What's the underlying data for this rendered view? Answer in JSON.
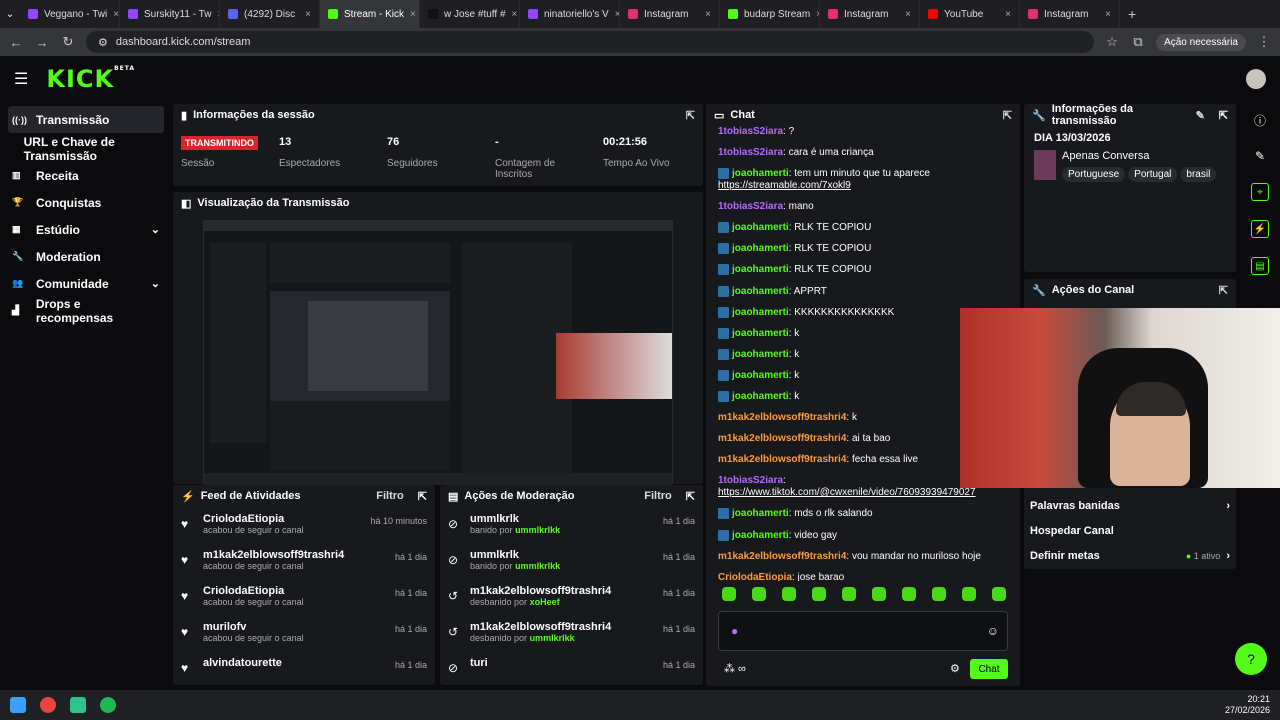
{
  "browser": {
    "tabs": [
      {
        "label": "Veggano - Twi",
        "color": "#9146ff"
      },
      {
        "label": "Surskity11 - Tw",
        "color": "#9146ff"
      },
      {
        "label": "(4292) Disc",
        "color": "#5865f2"
      },
      {
        "label": "Stream - Kick",
        "color": "#53fc18",
        "active": true
      },
      {
        "label": "w Jose #tuff #",
        "color": "#111111"
      },
      {
        "label": "ninatoriello's V",
        "color": "#9146ff"
      },
      {
        "label": "Instagram",
        "color": "#e1306c"
      },
      {
        "label": "budarp Stream",
        "color": "#53fc18"
      },
      {
        "label": "Instagram",
        "color": "#e1306c"
      },
      {
        "label": "YouTube",
        "color": "#ff0000"
      },
      {
        "label": "Instagram",
        "color": "#e1306c"
      }
    ],
    "url": "dashboard.kick.com/stream",
    "profile_label": "Ação necessária"
  },
  "brand": {
    "logo": "KICK",
    "logo_sup": "BETA",
    "accent": "#53fc18"
  },
  "sidebar": {
    "items": [
      {
        "label": "Transmissão",
        "icon": "broadcast-icon",
        "active": true
      },
      {
        "label": "URL e Chave de Transmissão",
        "icon": ""
      },
      {
        "label": "Receita",
        "icon": "chart-icon"
      },
      {
        "label": "Conquistas",
        "icon": "trophy-icon"
      },
      {
        "label": "Estúdio",
        "icon": "studio-icon",
        "chev": true
      },
      {
        "label": "Moderation",
        "icon": "wrench-icon"
      },
      {
        "label": "Comunidade",
        "icon": "people-icon",
        "chev": true
      },
      {
        "label": "Drops e recompensas",
        "icon": "gift-icon"
      }
    ]
  },
  "session": {
    "title": "Informações da sessão",
    "badge": "TRANSMITINDO",
    "badge_label": "Sessão",
    "stats": [
      {
        "value": "13",
        "label": "Espectadores"
      },
      {
        "value": "76",
        "label": "Seguidores"
      },
      {
        "value": "-",
        "label": "Contagem de Inscritos"
      },
      {
        "value": "00:21:56",
        "label": "Tempo Ao Vivo"
      }
    ]
  },
  "preview": {
    "title": "Visualização da Transmissão"
  },
  "activity": {
    "title": "Feed de Atividades",
    "filter": "Filtro",
    "items": [
      {
        "name": "CriolodaEtiopia",
        "sub": "acabou de seguir o canal",
        "time": "há 10 minutos"
      },
      {
        "name": "m1kak2elblowsoff9trashri4",
        "sub": "acabou de seguir o canal",
        "time": "há 1 dia"
      },
      {
        "name": "CriolodaEtiopia",
        "sub": "acabou de seguir o canal",
        "time": "há 1 dia"
      },
      {
        "name": "murilofv",
        "sub": "acabou de seguir o canal",
        "time": "há 1 dia"
      },
      {
        "name": "alvindatourette",
        "sub": "",
        "time": "há 1 dia"
      }
    ]
  },
  "moderation": {
    "title": "Ações de Moderação",
    "filter": "Filtro",
    "items": [
      {
        "name": "ummlkrlk",
        "sub": "banido por",
        "by": "ummlkrlkk",
        "time": "há 1 dia",
        "icon": "ban-icon"
      },
      {
        "name": "ummlkrlk",
        "sub": "banido por",
        "by": "ummlkrlkk",
        "time": "há 1 dia",
        "icon": "ban-icon"
      },
      {
        "name": "m1kak2elblowsoff9trashri4",
        "sub": "desbanido por",
        "by": "xoHeef",
        "time": "há 1 dia",
        "icon": "undo-icon"
      },
      {
        "name": "m1kak2elblowsoff9trashri4",
        "sub": "desbanido por",
        "by": "ummlkrlkk",
        "time": "há 1 dia",
        "icon": "undo-icon"
      },
      {
        "name": "turi",
        "sub": "",
        "by": "",
        "time": "há 1 dia",
        "icon": "ban-icon"
      }
    ]
  },
  "chat": {
    "title": "Chat",
    "send_label": "Chat",
    "messages": [
      {
        "user": "1tobiasS2iara",
        "color": "purple",
        "text": "?"
      },
      {
        "user": "1tobiasS2iara",
        "color": "purple",
        "text": "cara é uma criança"
      },
      {
        "user": "joaohamerti",
        "color": "green",
        "badge": true,
        "text": "tem um minuto que tu aparece",
        "link": "https://streamable.com/7xokl9"
      },
      {
        "user": "1tobiasS2iara",
        "color": "purple",
        "text": "mano"
      },
      {
        "user": "joaohamerti",
        "color": "green",
        "badge": true,
        "text": "RLK TE COPIOU"
      },
      {
        "user": "joaohamerti",
        "color": "green",
        "badge": true,
        "text": "RLK TE COPIOU"
      },
      {
        "user": "joaohamerti",
        "color": "green",
        "badge": true,
        "text": "RLK TE COPIOU"
      },
      {
        "user": "joaohamerti",
        "color": "green",
        "badge": true,
        "text": "APPRT"
      },
      {
        "user": "joaohamerti",
        "color": "green",
        "badge": true,
        "text": "KKKKKKKKKKKKKKK"
      },
      {
        "user": "joaohamerti",
        "color": "green",
        "badge": true,
        "text": "k"
      },
      {
        "user": "joaohamerti",
        "color": "green",
        "badge": true,
        "text": "k"
      },
      {
        "user": "joaohamerti",
        "color": "green",
        "badge": true,
        "text": "k"
      },
      {
        "user": "joaohamerti",
        "color": "green",
        "badge": true,
        "text": "k"
      },
      {
        "user": "m1kak2elblowsoff9trashri4",
        "color": "orange",
        "text": "k"
      },
      {
        "user": "m1kak2elblowsoff9trashri4",
        "color": "orange",
        "text": "ai ta bao"
      },
      {
        "user": "m1kak2elblowsoff9trashri4",
        "color": "orange",
        "text": "fecha essa live"
      },
      {
        "user": "1tobiasS2iara",
        "color": "purple",
        "text": "",
        "link": "https://www.tiktok.com/@cwxenile/video/76093939479027"
      },
      {
        "user": "joaohamerti",
        "color": "green",
        "badge": true,
        "text": "mds o rlk salando"
      },
      {
        "user": "joaohamerti",
        "color": "green",
        "badge": true,
        "text": "video gay"
      },
      {
        "user": "m1kak2elblowsoff9trashri4",
        "color": "orange",
        "text": "vou mandar no muriloso hoje"
      },
      {
        "user": "CriolodaEtiopia",
        "color": "orange",
        "text": "jose barao"
      }
    ]
  },
  "stream_info": {
    "title": "Informações da transmissão",
    "date": "DIA 13/03/2026",
    "category": "Apenas Conversa",
    "tags": [
      "Portuguese",
      "Portugal",
      "brasil"
    ]
  },
  "channel_actions": {
    "title": "Ações do Canal",
    "items": [
      {
        "label": "Palavras banidas"
      },
      {
        "label": "Hospedar Canal"
      },
      {
        "label": "Definir metas",
        "status": "1 ativo"
      }
    ]
  },
  "taskbar": {
    "time": "20:21",
    "date": "27/02/2026"
  }
}
